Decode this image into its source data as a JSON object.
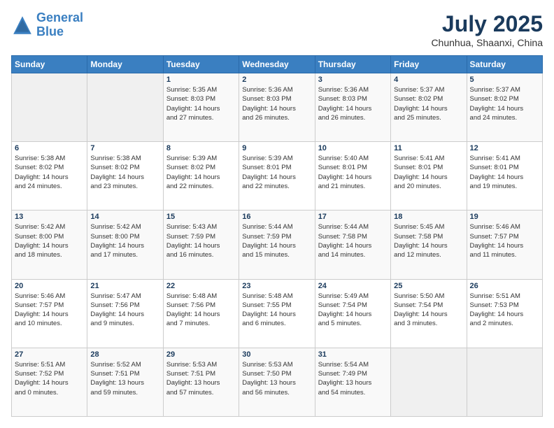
{
  "logo": {
    "line1": "General",
    "line2": "Blue"
  },
  "title": "July 2025",
  "location": "Chunhua, Shaanxi, China",
  "days_header": [
    "Sunday",
    "Monday",
    "Tuesday",
    "Wednesday",
    "Thursday",
    "Friday",
    "Saturday"
  ],
  "weeks": [
    [
      {
        "day": "",
        "content": ""
      },
      {
        "day": "",
        "content": ""
      },
      {
        "day": "1",
        "content": "Sunrise: 5:35 AM\nSunset: 8:03 PM\nDaylight: 14 hours\nand 27 minutes."
      },
      {
        "day": "2",
        "content": "Sunrise: 5:36 AM\nSunset: 8:03 PM\nDaylight: 14 hours\nand 26 minutes."
      },
      {
        "day": "3",
        "content": "Sunrise: 5:36 AM\nSunset: 8:03 PM\nDaylight: 14 hours\nand 26 minutes."
      },
      {
        "day": "4",
        "content": "Sunrise: 5:37 AM\nSunset: 8:02 PM\nDaylight: 14 hours\nand 25 minutes."
      },
      {
        "day": "5",
        "content": "Sunrise: 5:37 AM\nSunset: 8:02 PM\nDaylight: 14 hours\nand 24 minutes."
      }
    ],
    [
      {
        "day": "6",
        "content": "Sunrise: 5:38 AM\nSunset: 8:02 PM\nDaylight: 14 hours\nand 24 minutes."
      },
      {
        "day": "7",
        "content": "Sunrise: 5:38 AM\nSunset: 8:02 PM\nDaylight: 14 hours\nand 23 minutes."
      },
      {
        "day": "8",
        "content": "Sunrise: 5:39 AM\nSunset: 8:02 PM\nDaylight: 14 hours\nand 22 minutes."
      },
      {
        "day": "9",
        "content": "Sunrise: 5:39 AM\nSunset: 8:01 PM\nDaylight: 14 hours\nand 22 minutes."
      },
      {
        "day": "10",
        "content": "Sunrise: 5:40 AM\nSunset: 8:01 PM\nDaylight: 14 hours\nand 21 minutes."
      },
      {
        "day": "11",
        "content": "Sunrise: 5:41 AM\nSunset: 8:01 PM\nDaylight: 14 hours\nand 20 minutes."
      },
      {
        "day": "12",
        "content": "Sunrise: 5:41 AM\nSunset: 8:01 PM\nDaylight: 14 hours\nand 19 minutes."
      }
    ],
    [
      {
        "day": "13",
        "content": "Sunrise: 5:42 AM\nSunset: 8:00 PM\nDaylight: 14 hours\nand 18 minutes."
      },
      {
        "day": "14",
        "content": "Sunrise: 5:42 AM\nSunset: 8:00 PM\nDaylight: 14 hours\nand 17 minutes."
      },
      {
        "day": "15",
        "content": "Sunrise: 5:43 AM\nSunset: 7:59 PM\nDaylight: 14 hours\nand 16 minutes."
      },
      {
        "day": "16",
        "content": "Sunrise: 5:44 AM\nSunset: 7:59 PM\nDaylight: 14 hours\nand 15 minutes."
      },
      {
        "day": "17",
        "content": "Sunrise: 5:44 AM\nSunset: 7:58 PM\nDaylight: 14 hours\nand 14 minutes."
      },
      {
        "day": "18",
        "content": "Sunrise: 5:45 AM\nSunset: 7:58 PM\nDaylight: 14 hours\nand 12 minutes."
      },
      {
        "day": "19",
        "content": "Sunrise: 5:46 AM\nSunset: 7:57 PM\nDaylight: 14 hours\nand 11 minutes."
      }
    ],
    [
      {
        "day": "20",
        "content": "Sunrise: 5:46 AM\nSunset: 7:57 PM\nDaylight: 14 hours\nand 10 minutes."
      },
      {
        "day": "21",
        "content": "Sunrise: 5:47 AM\nSunset: 7:56 PM\nDaylight: 14 hours\nand 9 minutes."
      },
      {
        "day": "22",
        "content": "Sunrise: 5:48 AM\nSunset: 7:56 PM\nDaylight: 14 hours\nand 7 minutes."
      },
      {
        "day": "23",
        "content": "Sunrise: 5:48 AM\nSunset: 7:55 PM\nDaylight: 14 hours\nand 6 minutes."
      },
      {
        "day": "24",
        "content": "Sunrise: 5:49 AM\nSunset: 7:54 PM\nDaylight: 14 hours\nand 5 minutes."
      },
      {
        "day": "25",
        "content": "Sunrise: 5:50 AM\nSunset: 7:54 PM\nDaylight: 14 hours\nand 3 minutes."
      },
      {
        "day": "26",
        "content": "Sunrise: 5:51 AM\nSunset: 7:53 PM\nDaylight: 14 hours\nand 2 minutes."
      }
    ],
    [
      {
        "day": "27",
        "content": "Sunrise: 5:51 AM\nSunset: 7:52 PM\nDaylight: 14 hours\nand 0 minutes."
      },
      {
        "day": "28",
        "content": "Sunrise: 5:52 AM\nSunset: 7:51 PM\nDaylight: 13 hours\nand 59 minutes."
      },
      {
        "day": "29",
        "content": "Sunrise: 5:53 AM\nSunset: 7:51 PM\nDaylight: 13 hours\nand 57 minutes."
      },
      {
        "day": "30",
        "content": "Sunrise: 5:53 AM\nSunset: 7:50 PM\nDaylight: 13 hours\nand 56 minutes."
      },
      {
        "day": "31",
        "content": "Sunrise: 5:54 AM\nSunset: 7:49 PM\nDaylight: 13 hours\nand 54 minutes."
      },
      {
        "day": "",
        "content": ""
      },
      {
        "day": "",
        "content": ""
      }
    ]
  ]
}
